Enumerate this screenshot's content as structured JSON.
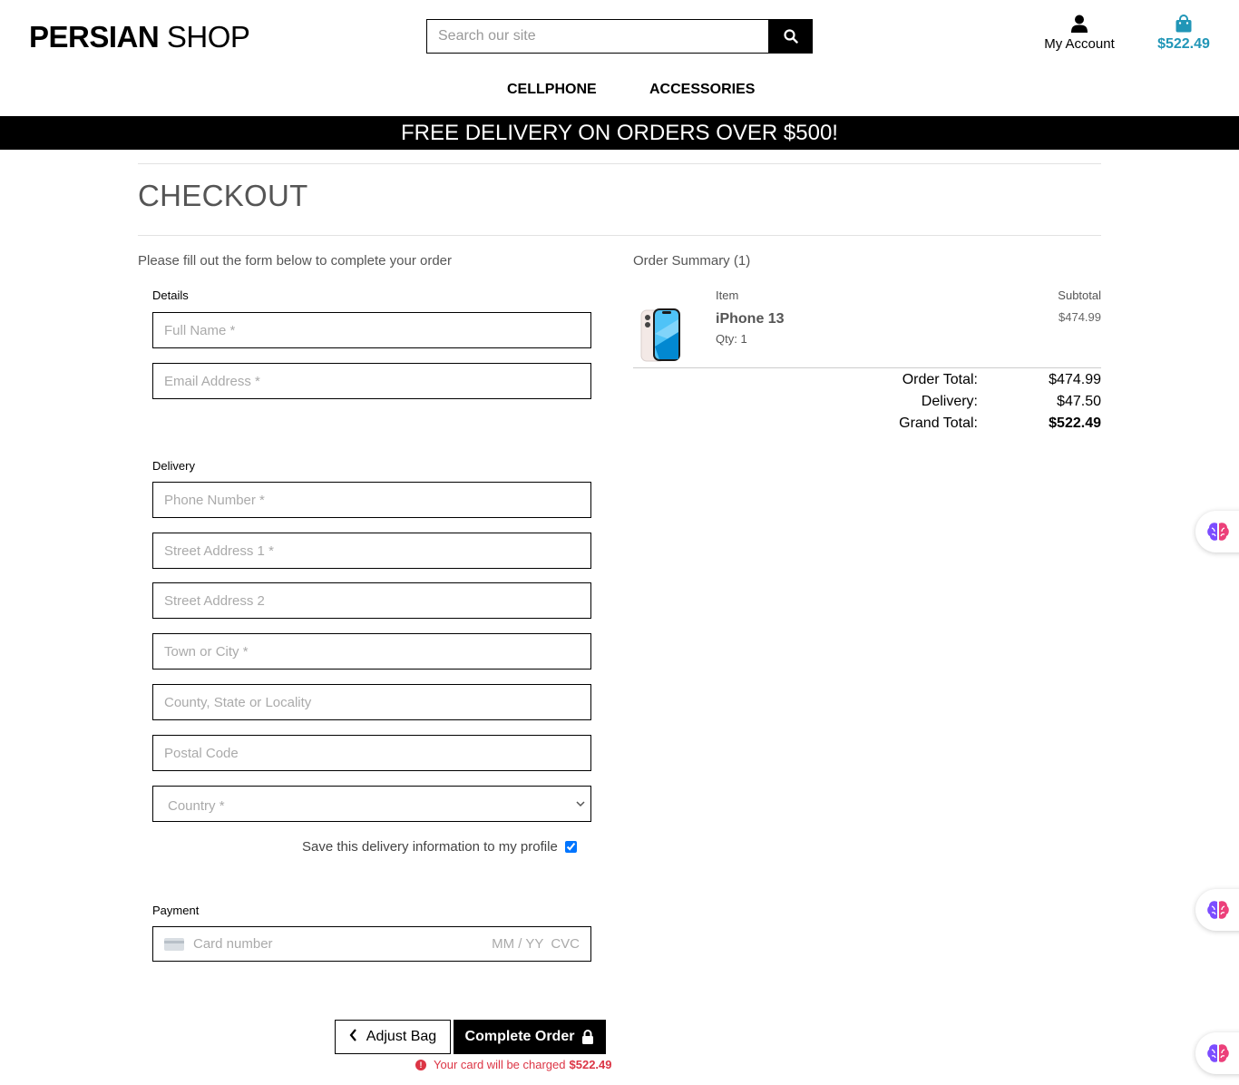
{
  "header": {
    "logo_bold": "PERSIAN",
    "logo_light": "SHOP",
    "search_placeholder": "Search our site",
    "account_label": "My Account",
    "bag_total": "$522.49"
  },
  "nav": {
    "items": [
      {
        "label": "CELLPHONE"
      },
      {
        "label": "ACCESSORIES"
      }
    ]
  },
  "banner": "FREE DELIVERY ON ORDERS OVER $500!",
  "page_title": "CHECKOUT",
  "intro": "Please fill out the form below to complete your order",
  "form": {
    "details_legend": "Details",
    "full_name_ph": "Full Name *",
    "email_ph": "Email Address *",
    "delivery_legend": "Delivery",
    "phone_ph": "Phone Number *",
    "street1_ph": "Street Address 1 *",
    "street2_ph": "Street Address 2",
    "town_ph": "Town or City *",
    "county_ph": "County, State or Locality",
    "postcode_ph": "Postal Code",
    "country_ph": "Country *",
    "save_info": "Save this delivery information to my profile",
    "save_checked": true,
    "payment_legend": "Payment",
    "card_number_ph": "Card number",
    "card_expiry_ph": "MM / YY",
    "card_cvc_ph": "CVC"
  },
  "buttons": {
    "adjust_bag": "Adjust Bag",
    "complete_order": "Complete Order"
  },
  "charge_notice": {
    "text": "Your card will be charged",
    "amount": "$522.49"
  },
  "summary": {
    "heading": "Order Summary (1)",
    "col_item": "Item",
    "col_subtotal": "Subtotal",
    "items": [
      {
        "name": "iPhone 13",
        "qty": "Qty: 1",
        "subtotal": "$474.99"
      }
    ],
    "order_total_label": "Order Total:",
    "order_total": "$474.99",
    "delivery_label": "Delivery:",
    "delivery": "$47.50",
    "grand_total_label": "Grand Total:",
    "grand_total": "$522.49"
  },
  "colors": {
    "accent": "#2196b7",
    "error": "#dc3545",
    "banner_bg": "#000000"
  },
  "icons": [
    "search-icon",
    "user-icon",
    "shopping-bag-icon",
    "chevron-left-icon",
    "lock-icon",
    "alert-circle-icon",
    "brain-icon"
  ]
}
